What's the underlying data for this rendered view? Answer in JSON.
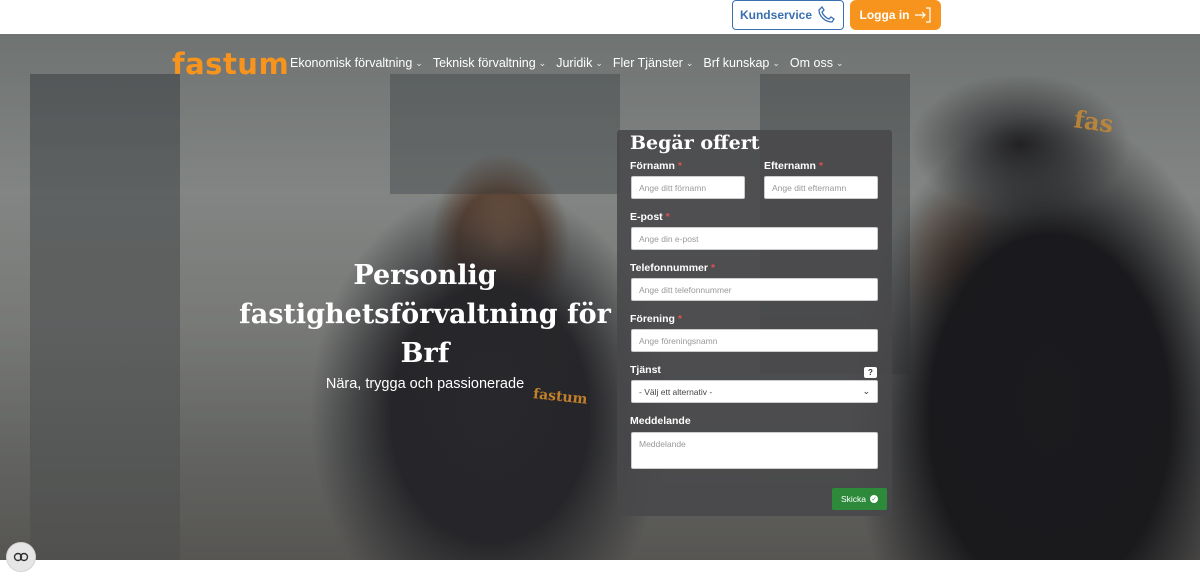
{
  "topbar": {
    "service_label": "Kundservice",
    "login_label": "Logga in"
  },
  "brand": {
    "logo_text": "fastum",
    "accent_color": "#f7941d"
  },
  "nav": {
    "items": [
      {
        "label": "Ekonomisk förvaltning"
      },
      {
        "label": "Teknisk förvaltning"
      },
      {
        "label": "Juridik"
      },
      {
        "label": "Fler Tjänster"
      },
      {
        "label": "Brf kunskap"
      },
      {
        "label": "Om oss"
      }
    ]
  },
  "hero": {
    "title": "Personlig fastighetsförvaltning för Brf",
    "subtitle": "Nära, trygga och passionerade",
    "shirt_logo": "fastum",
    "cap_logo": "fas"
  },
  "form": {
    "title": "Begär offert",
    "fields": {
      "first_name": {
        "label": "Förnamn",
        "placeholder": "Ange ditt förnamn"
      },
      "last_name": {
        "label": "Efternamn",
        "placeholder": "Ange ditt efternamn"
      },
      "email": {
        "label": "E-post",
        "placeholder": "Ange din e-post"
      },
      "phone": {
        "label": "Telefonnummer",
        "placeholder": "Ange ditt telefonnummer"
      },
      "association": {
        "label": "Förening",
        "placeholder": "Ange föreningsnamn"
      },
      "service": {
        "label": "Tjänst",
        "selected": "- Välj ett alternativ -"
      },
      "message": {
        "label": "Meddelande",
        "placeholder": "Meddelande"
      }
    },
    "required_marker": "*",
    "help_icon": "?",
    "submit_label": "Skicka",
    "submit_color": "#2d8a3a"
  },
  "icons": {
    "phone": "phone-icon",
    "login": "login-arrow-icon",
    "cookie": "cookie-settings-icon"
  }
}
